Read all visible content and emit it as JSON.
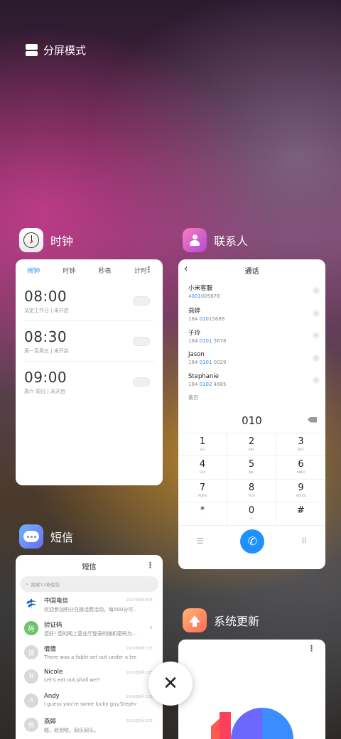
{
  "split_mode": {
    "label": "分屏模式"
  },
  "clock": {
    "app_name": "时钟",
    "tabs": [
      "闹钟",
      "时钟",
      "秒表",
      "计时"
    ],
    "alarms": [
      {
        "time": "08:00",
        "sub": "法定工作日 | 未开启"
      },
      {
        "time": "08:30",
        "sub": "周一至周五 | 未开启"
      },
      {
        "time": "09:00",
        "sub": "周六 周日 | 未开启"
      }
    ]
  },
  "contacts": {
    "app_name": "联系人",
    "title": "通话",
    "entries": [
      {
        "name": "小米客服",
        "pre": "4",
        "hl": "001",
        "post": "005678"
      },
      {
        "name": "燕婷",
        "pre": "184 ",
        "hl": "010",
        "post": "15689"
      },
      {
        "name": "子玲",
        "pre": "184 ",
        "hl": "0101",
        "post": " 5678"
      },
      {
        "name": "Jason",
        "pre": "184 ",
        "hl": "0101",
        "post": " 0029"
      },
      {
        "name": "Stephanie",
        "pre": "184 ",
        "hl": "0102",
        "post": " 4685"
      }
    ],
    "yellow_pages": "黄页",
    "input": "010",
    "keys": [
      {
        "num": "1",
        "letters": "GD"
      },
      {
        "num": "2",
        "letters": "ABC"
      },
      {
        "num": "3",
        "letters": "DEF"
      },
      {
        "num": "4",
        "letters": "GHI"
      },
      {
        "num": "5",
        "letters": "JKL"
      },
      {
        "num": "6",
        "letters": "MNO"
      },
      {
        "num": "7",
        "letters": "PQRS"
      },
      {
        "num": "8",
        "letters": "TUV"
      },
      {
        "num": "9",
        "letters": "WXYZ"
      },
      {
        "num": "*",
        "letters": ","
      },
      {
        "num": "0",
        "letters": "+"
      },
      {
        "num": "#",
        "letters": ""
      }
    ]
  },
  "sms": {
    "app_name": "短信",
    "title": "短信",
    "search_placeholder": "搜索11条短信",
    "messages": [
      {
        "name": "中国电信",
        "text": "欢迎参加积分兑换话费活动，每500分可…",
        "date": "2017年6月30日",
        "avatar": "",
        "color": "#ffffff"
      },
      {
        "name": "验证码",
        "text": "您好! 您的网上营业厅登录的随机密码为…",
        "date": "",
        "avatar": "码",
        "color": "#6cc36c"
      },
      {
        "name": "倩倩",
        "text": "There was a fable set out under a tree i…",
        "date": "2016年6月11日",
        "avatar": "倩",
        "color": "#d8d8d8"
      },
      {
        "name": "Nicole",
        "text": "Let's eat out,shall we?",
        "date": "2016年6月11日",
        "avatar": "N",
        "color": "#d8d8d8"
      },
      {
        "name": "Andy",
        "text": "I guess you're some lucky guy.Stephan…",
        "date": "2016年6月11日",
        "avatar": "A",
        "color": "#d8d8d8"
      },
      {
        "name": "燕婷",
        "text": "嗯，收到啦，同乐同乐。",
        "date": "2015年2月22日",
        "avatar": "燕",
        "color": "#d8d8d8"
      }
    ]
  },
  "update": {
    "app_name": "系统更新"
  },
  "close_glyph": "✕"
}
